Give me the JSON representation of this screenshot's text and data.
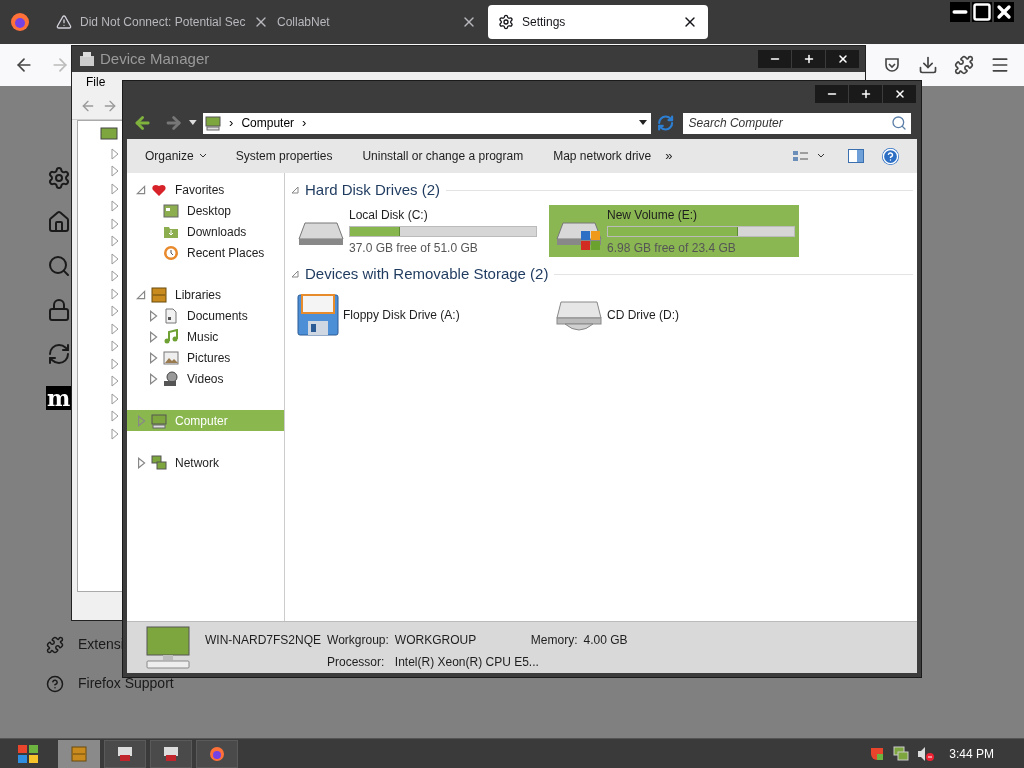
{
  "browser": {
    "tabs": [
      {
        "title": "Did Not Connect: Potential Sec",
        "kind": "warning",
        "selected": false
      },
      {
        "title": "CollabNet",
        "kind": "plain",
        "selected": false
      },
      {
        "title": "Settings",
        "kind": "settings",
        "selected": true
      }
    ],
    "sidebar_logo": "m",
    "footer_links": [
      {
        "label": "Extensi",
        "kind": "puzzle"
      },
      {
        "label": "Firefox Support",
        "kind": "help"
      }
    ]
  },
  "device_manager": {
    "title": "Device Manager",
    "menu": [
      "File"
    ]
  },
  "explorer": {
    "breadcrumb": "Computer",
    "breadcrumb_separator": "›",
    "search": {
      "placeholder": "Search Computer"
    },
    "toolbar": [
      "Organize",
      "System properties",
      "Uninstall or change a program",
      "Map network drive"
    ],
    "more": "»",
    "nav": [
      {
        "label": "Favorites",
        "kind": "favorites",
        "expanded": true,
        "selected": false,
        "children": [
          {
            "label": "Desktop",
            "kind": "desktop",
            "selected": false
          },
          {
            "label": "Downloads",
            "kind": "downloads",
            "selected": false
          },
          {
            "label": "Recent Places",
            "kind": "recent",
            "selected": false
          }
        ]
      },
      {
        "label": "Libraries",
        "kind": "libraries",
        "expanded": true,
        "selected": false,
        "children": [
          {
            "label": "Documents",
            "kind": "documents",
            "expanded": false,
            "selected": false
          },
          {
            "label": "Music",
            "kind": "music",
            "expanded": false,
            "selected": false
          },
          {
            "label": "Pictures",
            "kind": "pictures",
            "expanded": false,
            "selected": false
          },
          {
            "label": "Videos",
            "kind": "videos",
            "expanded": false,
            "selected": false
          }
        ]
      },
      {
        "label": "Computer",
        "kind": "computer",
        "expanded": false,
        "selected": true
      },
      {
        "label": "Network",
        "kind": "network",
        "expanded": false,
        "selected": false
      }
    ],
    "groups": [
      {
        "title": "Hard Disk Drives (2)",
        "expanded": true,
        "items": [
          {
            "name": "Local Disk (C:)",
            "kind": "hdd",
            "level": 0.27,
            "free": "37.0 GB free of 51.0 GB",
            "selected": false
          },
          {
            "name": "New Volume (E:)",
            "kind": "system",
            "level": 0.7,
            "free": "6.98 GB free of 23.4 GB",
            "selected": true
          }
        ]
      },
      {
        "title": "Devices with Removable Storage (2)",
        "expanded": true,
        "items": [
          {
            "name": "Floppy Disk Drive (A:)",
            "kind": "floppy",
            "selected": false
          },
          {
            "name": "CD Drive (D:)",
            "kind": "cd",
            "selected": false
          }
        ]
      }
    ],
    "details": {
      "computer": "WIN-NARD7FS2NQE",
      "workgroup_label": "Workgroup:",
      "workgroup": "WORKGROUP",
      "memory_label": "Memory:",
      "memory": "4.00 GB",
      "processor_label": "Processor:",
      "processor": "Intel(R) Xeon(R) CPU E5..."
    }
  },
  "taskbar": {
    "clock": "3:44 PM"
  }
}
